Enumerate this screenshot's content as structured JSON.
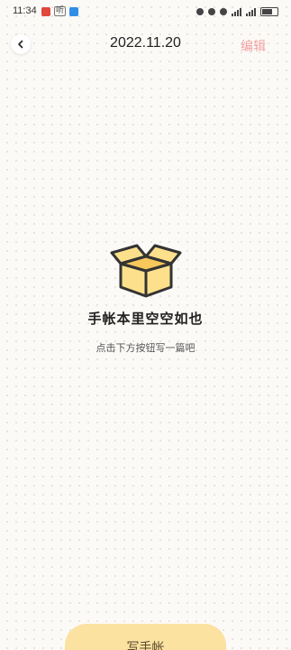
{
  "status_bar": {
    "time": "11:34",
    "listen_label": "听",
    "colors": {
      "app_red": "#e2483d",
      "app_blue": "#2f8ee8"
    }
  },
  "header": {
    "title": "2022.11.20",
    "edit_label": "编辑"
  },
  "empty_state": {
    "icon": "box-icon",
    "title": "手帐本里空空如也",
    "subtitle": "点击下方按钮写一篇吧"
  },
  "write_button": {
    "label": "写手帐"
  },
  "colors": {
    "accent_pink": "#f0a2a2",
    "button_yellow": "#fbe2a1",
    "box_fill": "#fde08b",
    "box_stroke": "#333333",
    "background": "#fcfaf7"
  }
}
